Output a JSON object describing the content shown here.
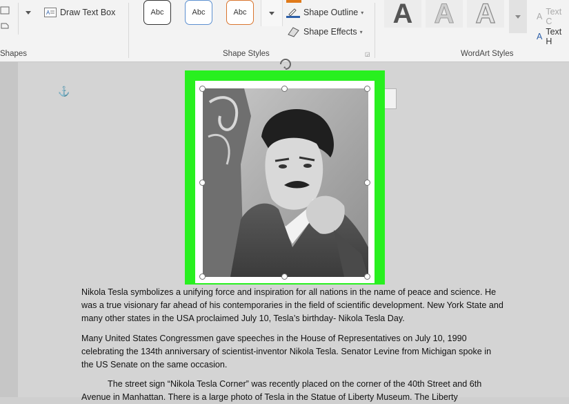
{
  "ribbon": {
    "shapes": {
      "label": "Shapes",
      "draw_text_box": "Draw Text Box"
    },
    "shape_styles": {
      "label": "Shape Styles",
      "presets": [
        {
          "label": "Abc",
          "border": "#333333"
        },
        {
          "label": "Abc",
          "border": "#5b8fd0"
        },
        {
          "label": "Abc",
          "border": "#d9742c"
        }
      ],
      "shape_outline": "Shape Outline",
      "shape_effects": "Shape Effects"
    },
    "wordart_styles": {
      "label": "WordArt Styles",
      "samples": [
        "A",
        "A",
        "A"
      ],
      "text_fill": "Text C",
      "text_outline": "Text H"
    }
  },
  "document": {
    "paragraphs": [
      "Nikola Tesla symbolizes a unifying force and inspiration for all nations in the name of peace and science. He was a true visionary far ahead of his contemporaries in the field of scientific development. New York State and many other states in the USA proclaimed July 10, Tesla’s birthday- Nikola Tesla Day.",
      "Many United States Congressmen gave speeches in the House of Representatives on July 10, 1990 celebrating the 134th anniversary of scientist-inventor Nikola Tesla. Senator Levine from Michigan spoke in the US Senate on the same occasion.",
      "The street sign “Nikola Tesla Corner” was recently placed on the corner of the 40th Street and 6th Avenue in Manhattan. There is a large photo of Tesla in the Statue of Liberty Museum. The Liberty"
    ]
  },
  "colors": {
    "highlight": "#28f01f",
    "accent": "#2c5fa8"
  }
}
